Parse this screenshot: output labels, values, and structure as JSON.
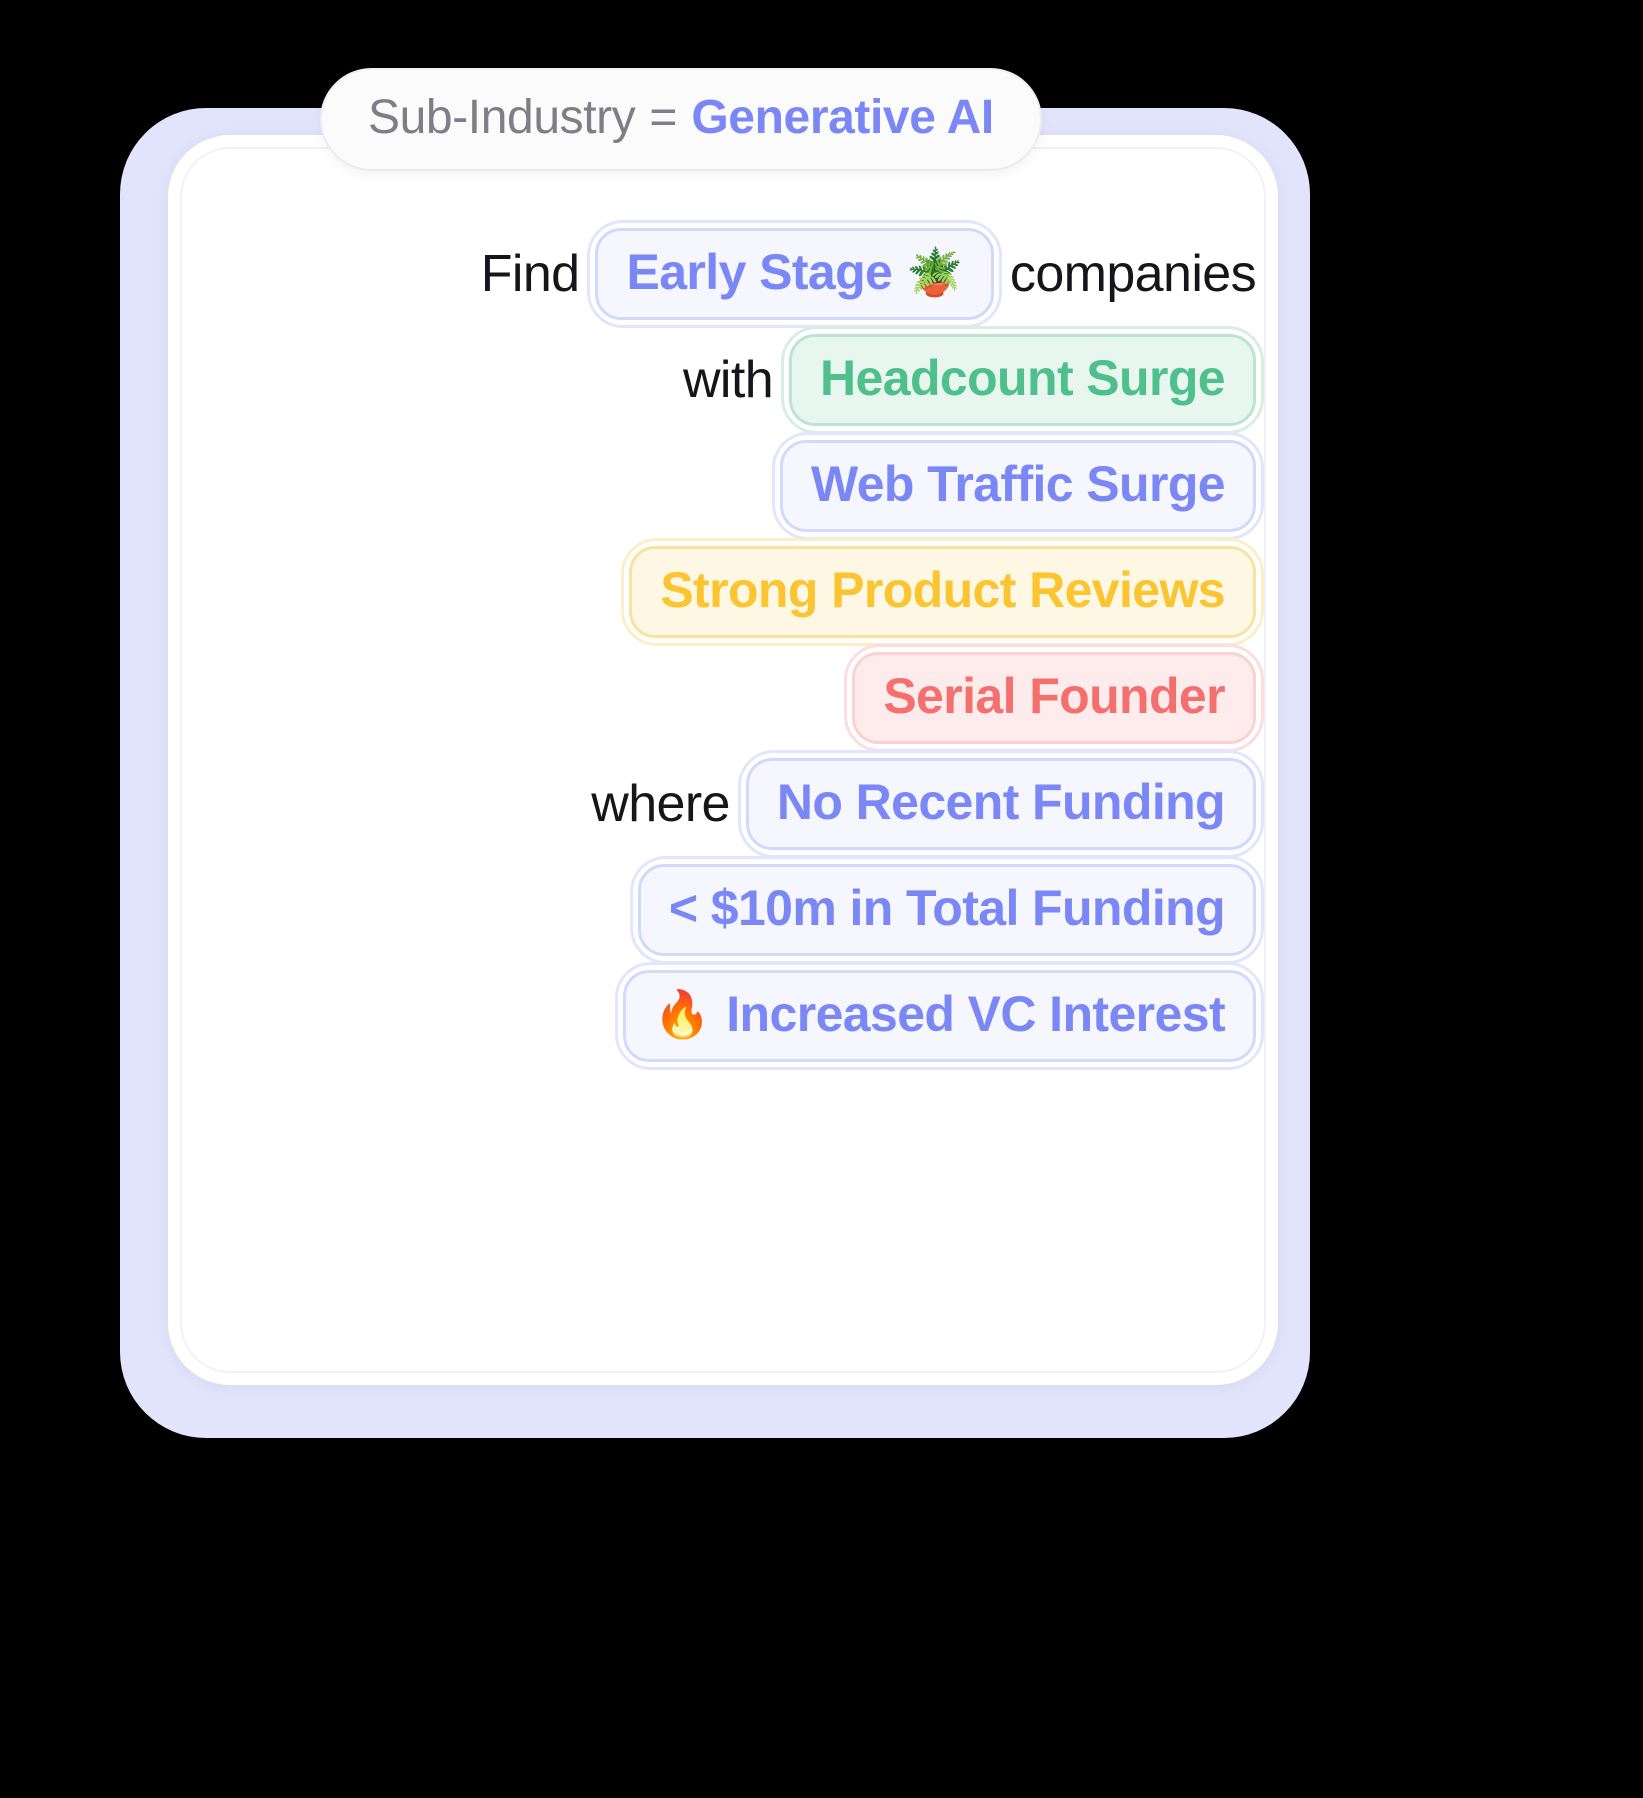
{
  "header": {
    "key": "Sub-Industry",
    "operator": "=",
    "value": "Generative AI",
    "value_color": "#7b87f5",
    "key_color": "#7e7e86"
  },
  "query": {
    "keywords": {
      "find": "Find",
      "with": "with",
      "where": "where",
      "companies": "companies"
    },
    "rows": [
      {
        "keyword": "Find",
        "chip": {
          "label": "Early Stage",
          "emoji": "🪴",
          "emoji_name": "potted-plant-emoji",
          "color": "blue"
        },
        "suffix": "companies"
      },
      {
        "keyword": "with",
        "chip": {
          "label": "Headcount Surge",
          "color": "green"
        }
      },
      {
        "keyword": "",
        "chip": {
          "label": "Web Traffic Surge",
          "color": "blue"
        }
      },
      {
        "keyword": "",
        "chip": {
          "label": "Strong Product Reviews",
          "color": "yellow"
        }
      },
      {
        "keyword": "",
        "chip": {
          "label": "Serial Founder",
          "color": "red"
        }
      },
      {
        "keyword": "where",
        "chip": {
          "label": "No Recent Funding",
          "color": "blue"
        }
      },
      {
        "keyword": "",
        "chip": {
          "label": "< $10m in Total Funding",
          "color": "blue"
        }
      },
      {
        "keyword": "",
        "chip": {
          "label": "Increased VC Interest",
          "emoji": "🔥",
          "emoji_name": "fire-emoji",
          "color": "blue"
        }
      }
    ]
  },
  "colors": {
    "accent_blue": "#7b87f5",
    "accent_green": "#4fbf8b",
    "accent_yellow": "#fbc531",
    "accent_red": "#f4706e",
    "frame": "#e2e4fb",
    "card": "#ffffff",
    "text_dark": "#16161a"
  }
}
